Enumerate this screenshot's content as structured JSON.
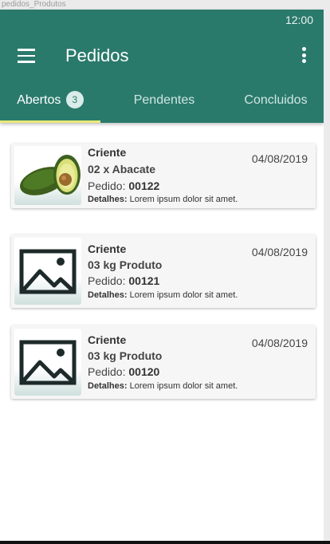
{
  "frame_label": "pedidos_Produtos",
  "status_bar": {
    "time": "12:00"
  },
  "app_bar": {
    "title": "Pedidos",
    "colors": {
      "primary": "#2a7a6c",
      "indicator": "#e6e87a"
    }
  },
  "tabs": [
    {
      "label": "Abertos",
      "badge": "3",
      "active": true
    },
    {
      "label": "Pendentes",
      "active": false
    },
    {
      "label": "Concluidos",
      "active": false
    }
  ],
  "orders": [
    {
      "client": "Criente",
      "date": "04/08/2019",
      "product": "02 x Abacate",
      "order_label": "Pedido:",
      "order_number": "00122",
      "details_label": "Detalhes:",
      "details_text": "Lorem ipsum dolor sit amet.",
      "image": "avocado-image"
    },
    {
      "client": "Criente",
      "date": "04/08/2019",
      "product": "03 kg Produto",
      "order_label": "Pedido:",
      "order_number": "00121",
      "details_label": "Detalhes:",
      "details_text": "Lorem ipsum dolor sit amet.",
      "image": "image-placeholder-icon"
    },
    {
      "client": "Criente",
      "date": "04/08/2019",
      "product": "03 kg Produto",
      "order_label": "Pedido:",
      "order_number": "00120",
      "details_label": "Detalhes:",
      "details_text": "Lorem ipsum dolor sit amet.",
      "image": "image-placeholder-icon"
    }
  ]
}
